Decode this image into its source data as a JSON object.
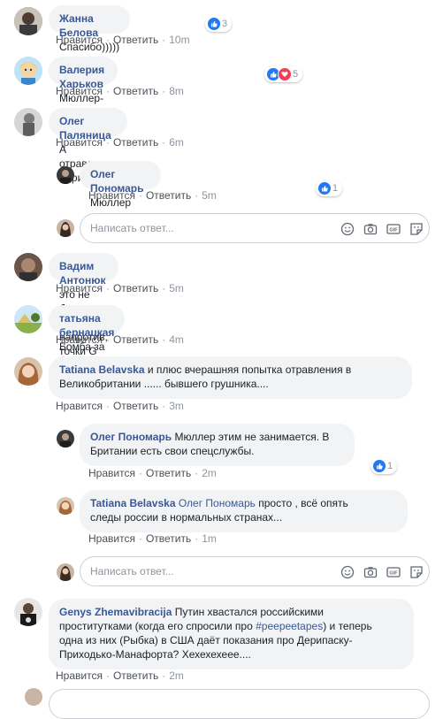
{
  "actions": {
    "like": "Нравится",
    "reply": "Ответить"
  },
  "reply_placeholder": "Написать ответ...",
  "comments": [
    {
      "author": "Жанна Белова",
      "text": "Спасибо)))))",
      "time": "10m",
      "reactions": "3"
    },
    {
      "author": "Валерия Харьков",
      "text": "Мюллер- красавец!",
      "time": "8m",
      "reactions": "5"
    },
    {
      "author": "Олег Паляница",
      "text": "А отравление Скрипаля?",
      "time": "6m"
    },
    {
      "author": "Олег Пономарь",
      "text": "Мюллер этим не занимается.",
      "time": "5m",
      "reactions": "1"
    },
    {
      "author": "Вадим Антонюк",
      "text": "это не болевые точки, а напротив, точки G",
      "time": "5m"
    },
    {
      "author": "татьяна бернацкая",
      "text": "Бомба за бомбой",
      "time": "4m"
    },
    {
      "author": "Tatiana Belavska",
      "text_line1": "и плюс вчерашняя попытка отравления в",
      "text_line2": "Великобритании ...... бывшего грушника....",
      "time": "3m"
    },
    {
      "author": "Олег Пономарь",
      "text_line1": "Мюллер этим не занимается. В",
      "text_line2": "Британии есть свои спецслужбы.",
      "time": "2m",
      "reactions": "1"
    },
    {
      "author": "Tatiana Belavska",
      "mention": "Олег Пономарь",
      "text_line1": "просто , всё опять",
      "text_line2": "следы россии в нормальных странах...",
      "time": "1m"
    },
    {
      "author": "Genys Zhemavibracija",
      "text_line1a": "Путин хвастался российскими",
      "text_line2a": "проститутками (когда его спросили про",
      "hashtag": "#peepeetapes",
      "text_line2b": ") и теперь",
      "text_line3": "одна из них (Рыбка) в США даёт показания про Дерипаску-",
      "text_line4": "Приходько-Манафорта? Хехехехеее....",
      "time": "2m"
    }
  ],
  "colors": {
    "link": "#385898",
    "bubble": "#f2f3f5",
    "like": "#2078f4",
    "love": "#f33e58"
  },
  "icons": [
    "emoji-icon",
    "camera-icon",
    "gif-icon",
    "sticker-icon",
    "like-reaction-icon",
    "love-reaction-icon"
  ]
}
